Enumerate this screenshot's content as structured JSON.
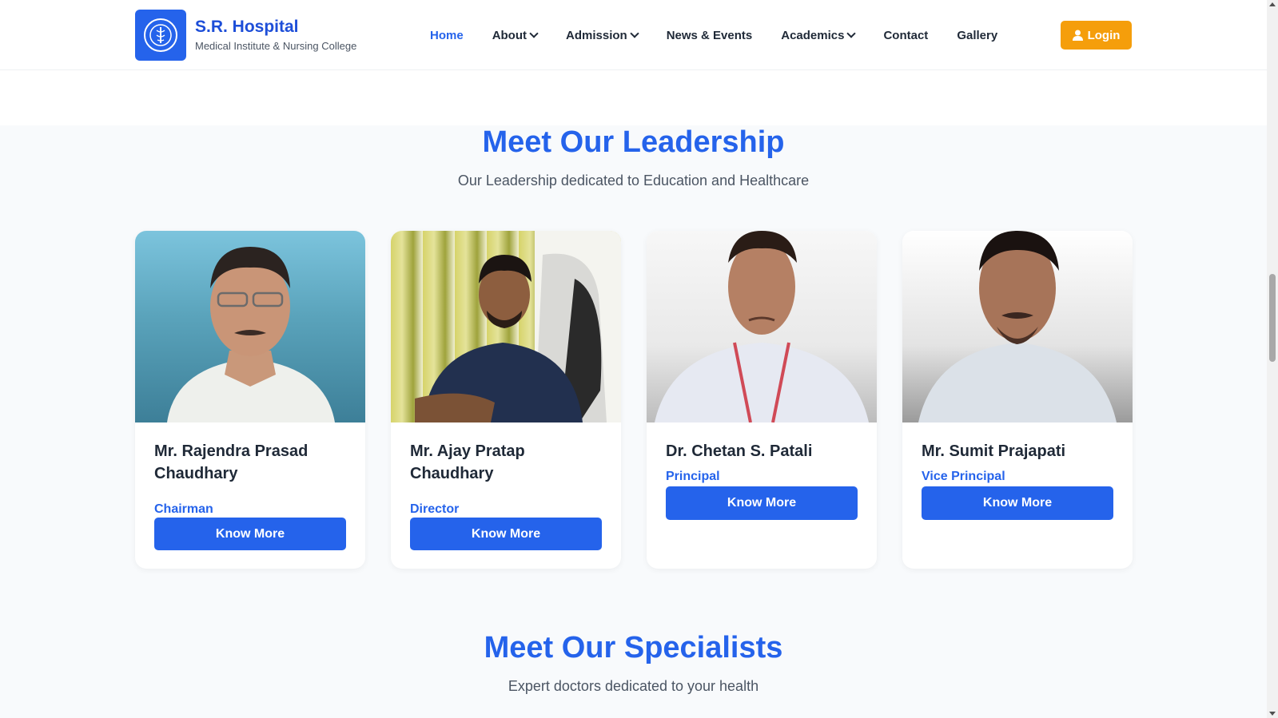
{
  "header": {
    "brand_title": "S.R. Hospital",
    "brand_subtitle": "Medical Institute & Nursing College",
    "nav": [
      {
        "label": "Home",
        "active": true,
        "dropdown": false
      },
      {
        "label": "About",
        "active": false,
        "dropdown": true
      },
      {
        "label": "Admission",
        "active": false,
        "dropdown": true
      },
      {
        "label": "News & Events",
        "active": false,
        "dropdown": false
      },
      {
        "label": "Academics",
        "active": false,
        "dropdown": true
      },
      {
        "label": "Contact",
        "active": false,
        "dropdown": false
      },
      {
        "label": "Gallery",
        "active": false,
        "dropdown": false
      }
    ],
    "login_label": "Login"
  },
  "leadership": {
    "title": "Meet Our Leadership",
    "subtitle": "Our Leadership dedicated to Education and Healthcare",
    "members": [
      {
        "name": "Mr. Rajendra Prasad Chaudhary",
        "role": "Chairman",
        "button": "Know More"
      },
      {
        "name": "Mr. Ajay Pratap Chaudhary",
        "role": "Director",
        "button": "Know More"
      },
      {
        "name": "Dr. Chetan S. Patali",
        "role": "Principal",
        "button": "Know More"
      },
      {
        "name": "Mr. Sumit Prajapati",
        "role": "Vice Principal",
        "button": "Know More"
      }
    ]
  },
  "specialists": {
    "title": "Meet Our Specialists",
    "subtitle": "Expert doctors dedicated to your health"
  },
  "colors": {
    "primary": "#2563eb",
    "accent": "#f59e0b",
    "background": "#f8fafc"
  }
}
